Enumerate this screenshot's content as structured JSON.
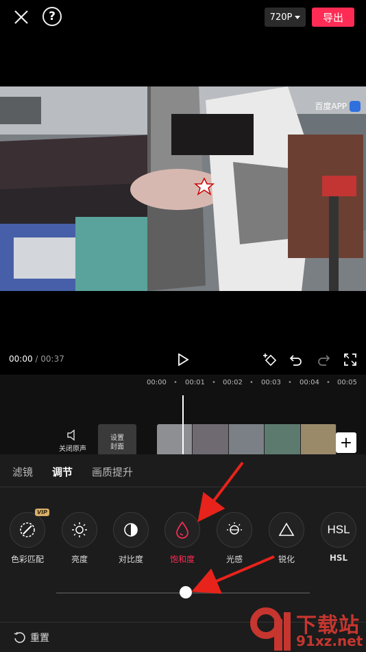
{
  "header": {
    "resolution": "720P",
    "export_label": "导出"
  },
  "preview": {
    "watermark": "百度APP"
  },
  "playback": {
    "current_time": "00:00",
    "total_time": "/ 00:37"
  },
  "timeline": {
    "ruler": [
      "00:00",
      "00:01",
      "00:02",
      "00:03",
      "00:04",
      "00:05"
    ],
    "mute_label": "关闭原声",
    "cover_label_line1": "设置",
    "cover_label_line2": "封面"
  },
  "adjust_panel": {
    "tabs": [
      {
        "label": "滤镜"
      },
      {
        "label": "调节"
      },
      {
        "label": "画质提升"
      }
    ],
    "tools": [
      {
        "label": "色彩匹配",
        "badge": "VIP"
      },
      {
        "label": "亮度"
      },
      {
        "label": "对比度"
      },
      {
        "label": "饱和度"
      },
      {
        "label": "光感"
      },
      {
        "label": "锐化"
      },
      {
        "label": "HSL"
      }
    ],
    "slider_value": 0.5,
    "reset_label": "重置"
  },
  "site_logo": {
    "title": "下载站",
    "domain": "91xz.net",
    "accent_color": "#c6362f"
  },
  "colors": {
    "accent": "#fe2c55",
    "arrow": "#e8231b"
  }
}
